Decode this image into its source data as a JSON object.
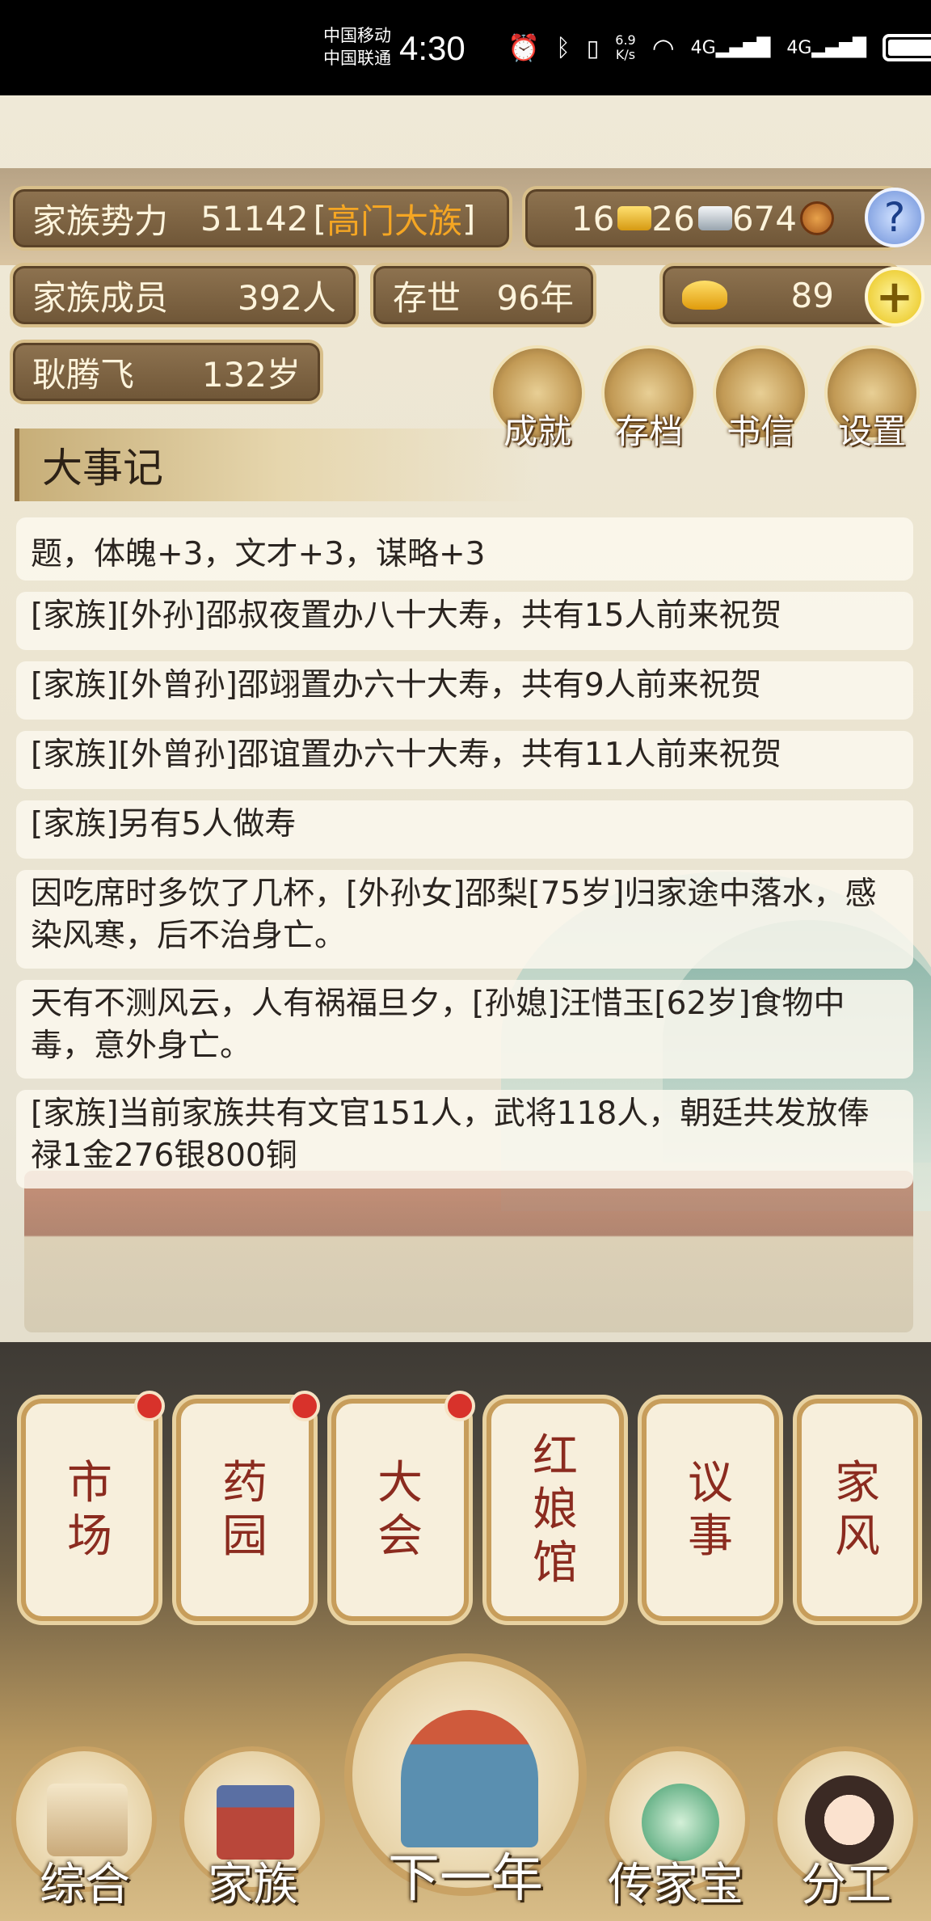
{
  "status_bar": {
    "carrier1": "中国移动",
    "carrier2": "中国联通",
    "time": "4:30",
    "net_speed_value": "6.9",
    "net_speed_unit": "K/s",
    "net_type1": "4G",
    "net_type2": "4G",
    "icons": [
      "alarm-icon",
      "bluetooth-icon",
      "vibrate-icon",
      "wifi-icon",
      "signal-icon",
      "battery-icon"
    ]
  },
  "header": {
    "family_power_label": "家族势力",
    "family_power_value": "51142",
    "family_rank_open": "[",
    "family_rank": "高门大族",
    "family_rank_close": "]",
    "gold": "16",
    "silver": "26",
    "copper": "674",
    "members_label": "家族成员",
    "members_value": "392人",
    "generations_label": "存世",
    "generations_value": "96年",
    "ingots": "89",
    "patriarch_name": "耿腾飞",
    "patriarch_age": "132岁"
  },
  "top_menu": [
    {
      "label": "成就",
      "icon": "achievement-icon"
    },
    {
      "label": "存档",
      "icon": "save-icon"
    },
    {
      "label": "书信",
      "icon": "letter-icon"
    },
    {
      "label": "设置",
      "icon": "settings-icon"
    }
  ],
  "chronicle": {
    "title": "大事记",
    "entries": [
      "题，体魄+3，文才+3，谋略+3",
      "[家族][外孙]邵叔夜置办八十大寿，共有15人前来祝贺",
      "[家族][外曾孙]邵翊置办六十大寿，共有9人前来祝贺",
      "[家族][外曾孙]邵谊置办六十大寿，共有11人前来祝贺",
      "[家族]另有5人做寿",
      "因吃席时多饮了几杯，[外孙女]邵梨[75岁]归家途中落水，感染风寒，后不治身亡。",
      "天有不测风云，人有祸福旦夕，[孙媳]汪惜玉[62岁]食物中毒，意外身亡。",
      "[家族]当前家族共有文官151人，武将118人，朝廷共发放俸禄1金276银800铜"
    ]
  },
  "feature_cards": [
    {
      "label": "市场",
      "has_dot": true
    },
    {
      "label": "药园",
      "has_dot": true
    },
    {
      "label": "大会",
      "has_dot": true
    },
    {
      "label": "红娘馆",
      "has_dot": false
    },
    {
      "label": "议事",
      "has_dot": false
    },
    {
      "label": "家风",
      "has_dot": false
    }
  ],
  "bottom_nav": [
    {
      "label": "综合",
      "icon": "scroll-icon"
    },
    {
      "label": "家族",
      "icon": "ancestral-hall-icon"
    },
    {
      "label": "下一年",
      "icon": "mountain-sun-icon"
    },
    {
      "label": "传家宝",
      "icon": "jade-pendant-icon"
    },
    {
      "label": "分工",
      "icon": "family-couple-icon"
    }
  ],
  "colors": {
    "rank_text": "#f5a623",
    "card_text": "#8b2b1f",
    "badge_red": "#d8322b"
  }
}
